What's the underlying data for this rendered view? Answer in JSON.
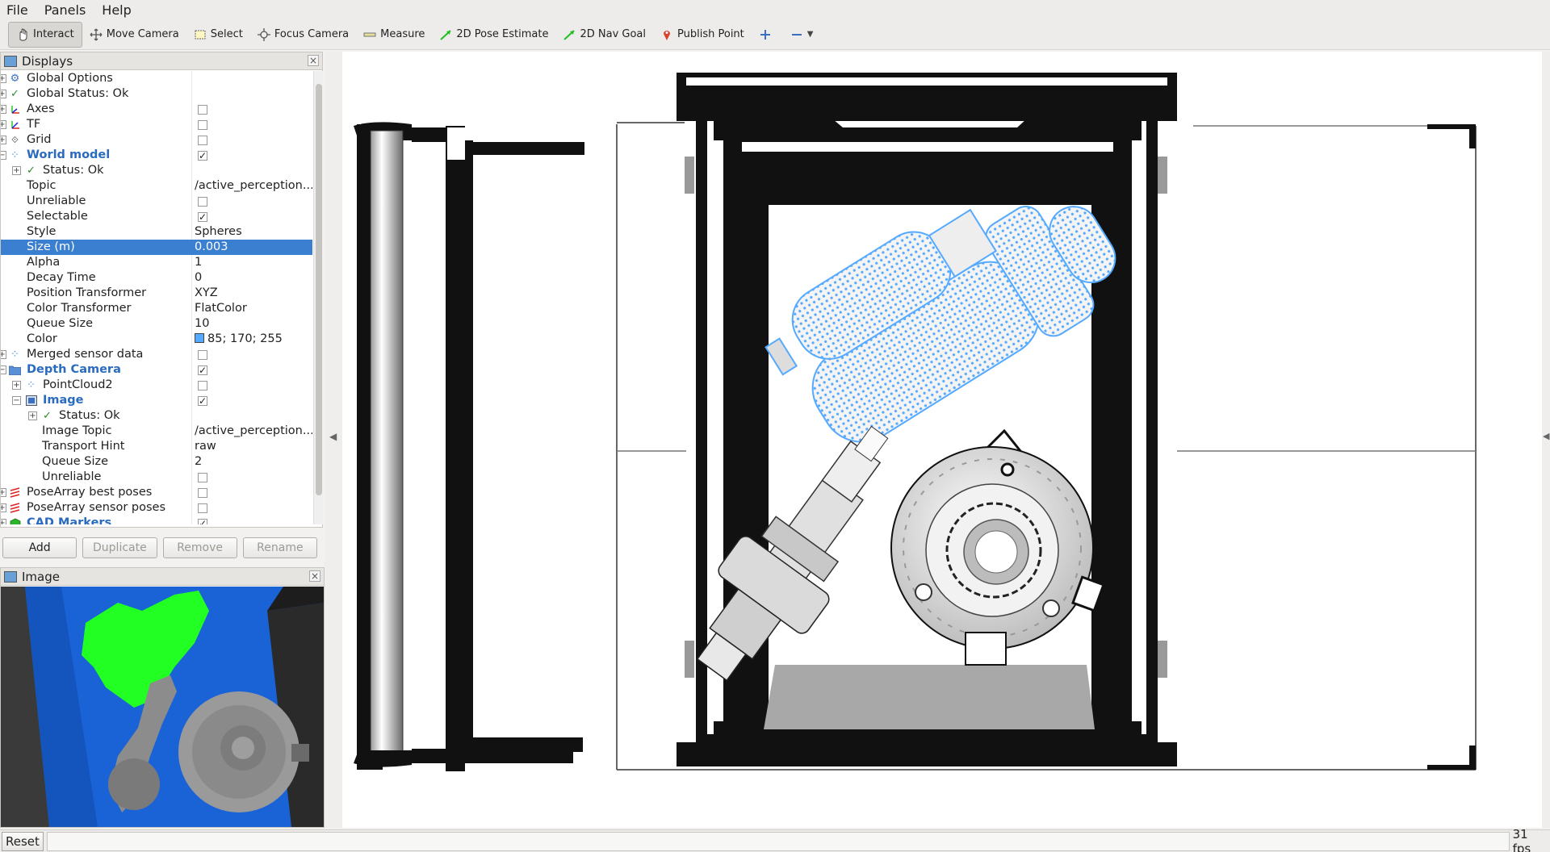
{
  "menubar": {
    "items": [
      "File",
      "Panels",
      "Help"
    ]
  },
  "toolbar": {
    "tools": [
      {
        "label": "Interact",
        "icon": "hand-icon"
      },
      {
        "label": "Move Camera",
        "icon": "move-camera-icon"
      },
      {
        "label": "Select",
        "icon": "select-icon"
      },
      {
        "label": "Focus Camera",
        "icon": "focus-camera-icon"
      },
      {
        "label": "Measure",
        "icon": "ruler-icon"
      },
      {
        "label": "2D Pose Estimate",
        "icon": "pose-arrow-icon"
      },
      {
        "label": "2D Nav Goal",
        "icon": "nav-arrow-icon"
      },
      {
        "label": "Publish Point",
        "icon": "map-pin-icon"
      }
    ],
    "active": "Interact"
  },
  "displays": {
    "title": "Displays",
    "rows": [
      {
        "name": "Global Options",
        "value": ""
      },
      {
        "name": "Global Status: Ok",
        "value": ""
      },
      {
        "name": "Axes",
        "value": ""
      },
      {
        "name": "TF",
        "value": ""
      },
      {
        "name": "Grid",
        "value": ""
      },
      {
        "name": "World model",
        "value": ""
      },
      {
        "name": "Status: Ok",
        "value": ""
      },
      {
        "name": "Topic",
        "value": "/active_perception..."
      },
      {
        "name": "Unreliable",
        "value": ""
      },
      {
        "name": "Selectable",
        "value": ""
      },
      {
        "name": "Style",
        "value": "Spheres"
      },
      {
        "name": "Size (m)",
        "value": "0.003"
      },
      {
        "name": "Alpha",
        "value": "1"
      },
      {
        "name": "Decay Time",
        "value": "0"
      },
      {
        "name": "Position Transformer",
        "value": "XYZ"
      },
      {
        "name": "Color Transformer",
        "value": "FlatColor"
      },
      {
        "name": "Queue Size",
        "value": "10"
      },
      {
        "name": "Color",
        "value": "85; 170; 255"
      },
      {
        "name": "Merged sensor data",
        "value": ""
      },
      {
        "name": "Depth Camera",
        "value": ""
      },
      {
        "name": "PointCloud2",
        "value": ""
      },
      {
        "name": "Image",
        "value": ""
      },
      {
        "name": "Status: Ok",
        "value": ""
      },
      {
        "name": "Image Topic",
        "value": "/active_perception..."
      },
      {
        "name": "Transport Hint",
        "value": "raw"
      },
      {
        "name": "Queue Size",
        "value": "2"
      },
      {
        "name": "Unreliable",
        "value": ""
      },
      {
        "name": "PoseArray best poses",
        "value": ""
      },
      {
        "name": "PoseArray sensor poses",
        "value": ""
      },
      {
        "name": "CAD Markers",
        "value": ""
      }
    ],
    "buttons": {
      "add": "Add",
      "duplicate": "Duplicate",
      "remove": "Remove",
      "rename": "Rename"
    },
    "color_swatch": "#55aaff"
  },
  "image_panel": {
    "title": "Image"
  },
  "statusbar": {
    "reset": "Reset",
    "fps": "31 fps"
  },
  "colors": {
    "selection": "#3b7fd0",
    "point_cloud": "#55aaff",
    "mask": "#22ff22",
    "camera_bg": "#1a63d6"
  }
}
